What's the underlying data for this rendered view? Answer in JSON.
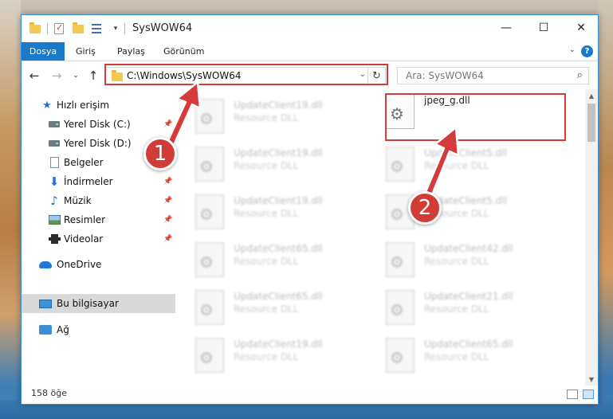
{
  "window": {
    "title": "SysWOW64",
    "controls": {
      "minimize": "—",
      "maximize": "☐",
      "close": "✕"
    }
  },
  "ribbon": {
    "tabs": [
      "Dosya",
      "Giriş",
      "Paylaş",
      "Görünüm"
    ],
    "help": "?"
  },
  "nav": {
    "address": "C:\\Windows\\SysWOW64",
    "search_placeholder": "Ara: SysWOW64"
  },
  "sidebar": {
    "items": [
      {
        "label": "Hızlı erişim",
        "icon": "star-icon"
      },
      {
        "label": "Yerel Disk (C:)",
        "icon": "drive-icon",
        "pinned": true
      },
      {
        "label": "Yerel Disk (D:)",
        "icon": "drive-icon",
        "pinned": true
      },
      {
        "label": "Belgeler",
        "icon": "document-icon",
        "pinned": true
      },
      {
        "label": "İndirmeler",
        "icon": "download-icon",
        "pinned": true
      },
      {
        "label": "Müzik",
        "icon": "music-icon",
        "pinned": true
      },
      {
        "label": "Resimler",
        "icon": "pictures-icon",
        "pinned": true
      },
      {
        "label": "Videolar",
        "icon": "videos-icon",
        "pinned": true
      },
      {
        "label": "OneDrive",
        "icon": "cloud-icon"
      },
      {
        "label": "Bu bilgisayar",
        "icon": "computer-icon",
        "selected": true
      },
      {
        "label": "Ağ",
        "icon": "network-icon"
      }
    ]
  },
  "files": {
    "left": [
      {
        "name": "UpdateClient19.dll",
        "type": "Resource DLL"
      },
      {
        "name": "UpdateClient19.dll",
        "type": "Resource DLL"
      },
      {
        "name": "UpdateClient19.dll",
        "type": "Resource DLL"
      },
      {
        "name": "UpdateClient65.dll",
        "type": "Resource DLL"
      },
      {
        "name": "UpdateClient65.dll",
        "type": "Resource DLL"
      },
      {
        "name": "UpdateClient19.dll",
        "type": "Resource DLL"
      }
    ],
    "right": [
      {
        "name": "jpeg_g.dll",
        "type": "",
        "focus": true
      },
      {
        "name": "UpdateClient5.dll",
        "type": "Resource DLL"
      },
      {
        "name": "UpdateClient5.dll",
        "type": "Resource DLL"
      },
      {
        "name": "UpdateClient42.dll",
        "type": "Resource DLL"
      },
      {
        "name": "UpdateClient21.dll",
        "type": "Resource DLL"
      },
      {
        "name": "UpdateClient65.dll",
        "type": "Resource DLL"
      }
    ]
  },
  "status": {
    "count": "158 öğe"
  },
  "annotations": {
    "step1": "1",
    "step2": "2",
    "color": "#d63b3b"
  }
}
